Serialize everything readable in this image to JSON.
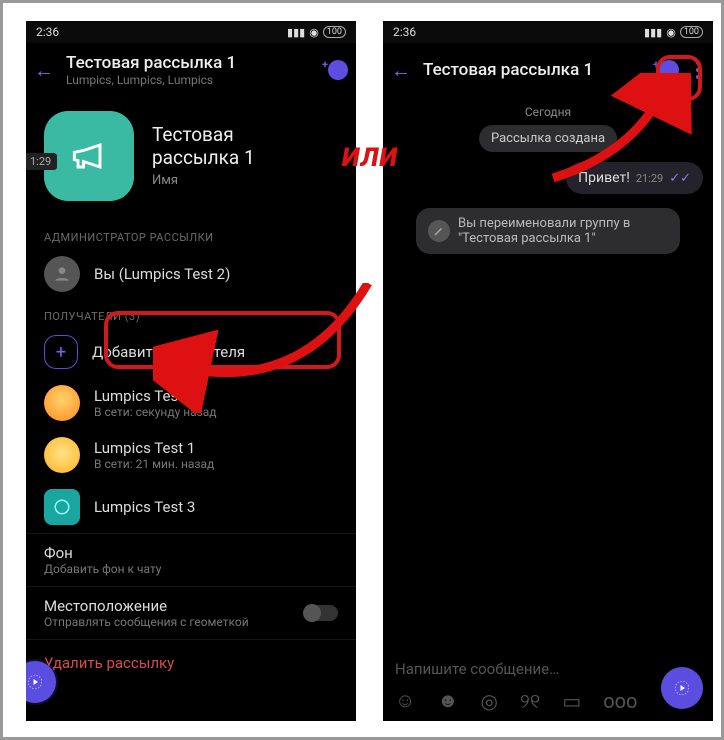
{
  "status": {
    "time": "2:36",
    "battery": "100"
  },
  "left": {
    "header": {
      "title": "Тестовая рассылка 1",
      "subtitle": "Lumpics, Lumpics, Lumpics"
    },
    "profile": {
      "title": "Тестовая\nрассылка 1",
      "sub": "Имя"
    },
    "side_time": "1:29",
    "sections": {
      "admin_label": "АДМИНИСТРАТОР РАССЫЛКИ",
      "admin_name": "Вы (Lumpics Test 2)",
      "recipients_label": "ПОЛУЧАТЕЛИ (3)",
      "add_recipient": "Добавить получателя",
      "recipients": [
        {
          "name": "Lumpics Test",
          "status": "В сети: секунду назад"
        },
        {
          "name": "Lumpics Test 1",
          "status": "В сети: 21 мин. назад"
        },
        {
          "name": "Lumpics Test 3",
          "status": ""
        }
      ]
    },
    "settings": {
      "bg_title": "Фон",
      "bg_sub": "Добавить фон к чату",
      "loc_title": "Местоположение",
      "loc_sub": "Отправлять сообщения с геометкой"
    },
    "delete": "Удалить рассылку"
  },
  "right": {
    "header": {
      "title": "Тестовая рассылка 1"
    },
    "date": "Сегодня",
    "created_pill": "Рассылка создана",
    "msg": {
      "text": "Привет!",
      "time": "21:29"
    },
    "sys": "Вы переименовали группу в \"Тестовая рассылка 1\"",
    "composer_placeholder": "Напишите сообщение…"
  },
  "overlay": {
    "or": "ИЛИ"
  }
}
